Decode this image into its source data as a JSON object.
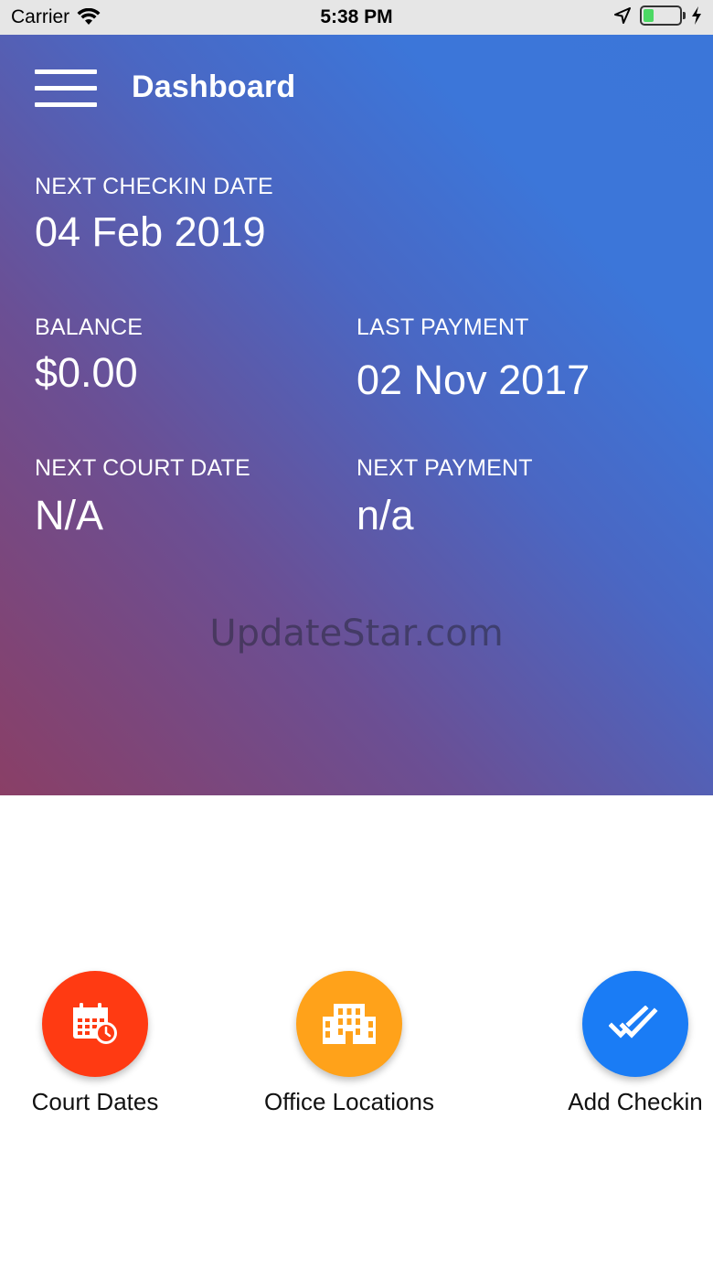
{
  "status_bar": {
    "carrier": "Carrier",
    "time": "5:38 PM",
    "battery_level": 0.3,
    "wifi_icon": "wifi-icon",
    "location_icon": "location-arrow-icon",
    "charging_icon": "bolt-icon"
  },
  "header": {
    "title": "Dashboard",
    "menu_icon": "hamburger-menu-icon"
  },
  "stats": {
    "next_checkin": {
      "label": "NEXT CHECKIN DATE",
      "value": "04 Feb 2019"
    },
    "balance": {
      "label": "BALANCE",
      "value": "$0.00"
    },
    "last_payment": {
      "label": "LAST PAYMENT",
      "value": "02 Nov 2017"
    },
    "next_court": {
      "label": "NEXT COURT DATE",
      "value": "N/A"
    },
    "next_payment": {
      "label": "NEXT PAYMENT",
      "value": "n/a"
    }
  },
  "watermark": "UpdateStar.com",
  "actions": [
    {
      "label": "Court Dates",
      "icon": "calendar-clock-icon",
      "color": "#ff3a12"
    },
    {
      "label": "Office Locations",
      "icon": "building-icon",
      "color": "#ffa21a"
    },
    {
      "label": "Add Checkin",
      "icon": "double-check-icon",
      "color": "#1a7cf5"
    }
  ],
  "colors": {
    "hero_gradient_start": "#8a3f66",
    "hero_gradient_end": "#3b76d9"
  }
}
